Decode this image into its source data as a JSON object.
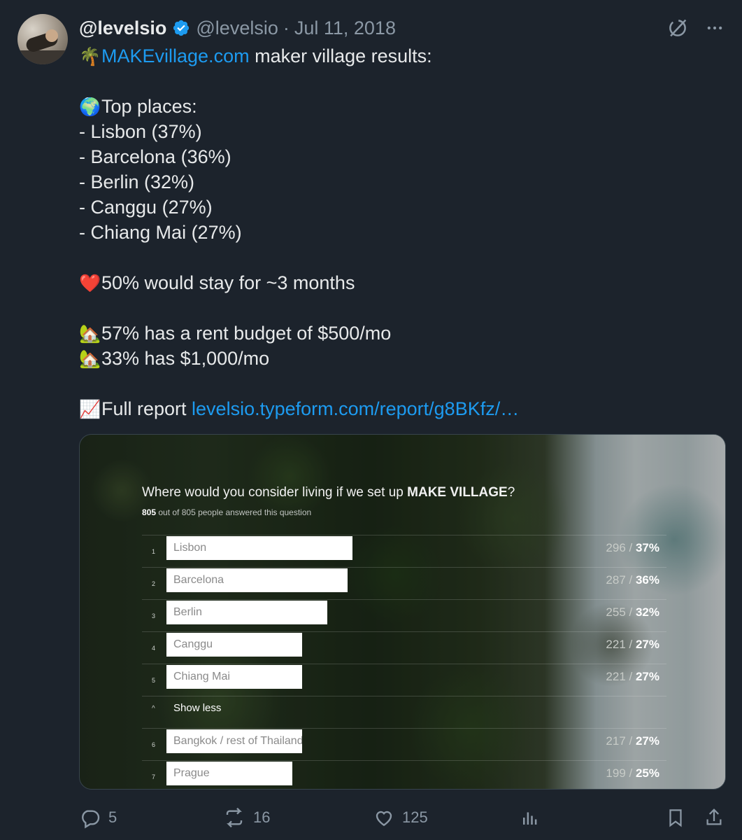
{
  "author": {
    "display_name": "@levelsio",
    "handle": "@levelsio",
    "separator": "·",
    "date": "Jul 11, 2018"
  },
  "tweet": {
    "line1_emoji": "🌴",
    "line1_link": "MAKEvillage.com",
    "line1_text": " maker village results:",
    "places_emoji": "🌍",
    "places_heading": "Top places:",
    "places": [
      "- Lisbon (37%)",
      "- Barcelona (36%)",
      "- Berlin (32%)",
      "- Canggu (27%)",
      "- Chiang Mai (27%)"
    ],
    "stay_emoji": "❤️",
    "stay_text": "50% would stay for ~3 months",
    "rent1_emoji": "🏡",
    "rent1_text": "57% has a rent budget of $500/mo",
    "rent2_emoji": "🏡",
    "rent2_text": "33% has $1,000/mo",
    "report_emoji": "📈",
    "report_text": "Full report ",
    "report_link": "levelsio.typeform.com/report/g8BKfz/…"
  },
  "media": {
    "question_prefix": "Where would you consider living if we set up ",
    "question_bold": "MAKE VILLAGE",
    "question_suffix": "?",
    "answered_count": "805",
    "answered_text": " out of 805 people answered this question",
    "rows": [
      {
        "num": "1",
        "label": "Lisbon",
        "count": "296",
        "pct": "37%",
        "fill": 0.37
      },
      {
        "num": "2",
        "label": "Barcelona",
        "count": "287",
        "pct": "36%",
        "fill": 0.36
      },
      {
        "num": "3",
        "label": "Berlin",
        "count": "255",
        "pct": "32%",
        "fill": 0.32
      },
      {
        "num": "4",
        "label": "Canggu",
        "count": "221",
        "pct": "27%",
        "fill": 0.27
      },
      {
        "num": "5",
        "label": "Chiang Mai",
        "count": "221",
        "pct": "27%",
        "fill": 0.27
      }
    ],
    "toggle_label": "Show less",
    "rows_after": [
      {
        "num": "6",
        "label": "Bangkok / rest of Thailand",
        "count": "217",
        "pct": "27%",
        "fill": 0.27
      },
      {
        "num": "7",
        "label": "Prague",
        "count": "199",
        "pct": "25%",
        "fill": 0.25
      }
    ]
  },
  "actions": {
    "replies": "5",
    "reposts": "16",
    "likes": "125"
  },
  "colors": {
    "background": "#1c232c",
    "link": "#1d9bf0",
    "verified": "#1d9bf0",
    "muted": "#8b98a5"
  }
}
